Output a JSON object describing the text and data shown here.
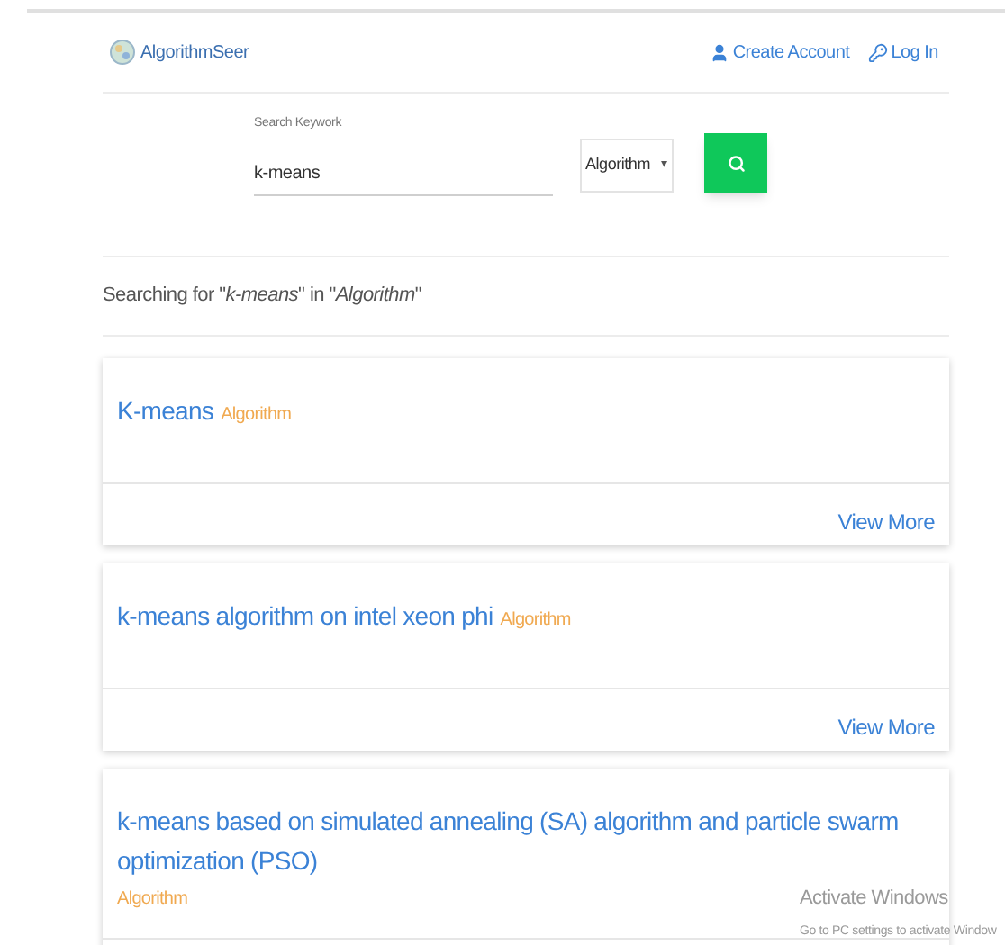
{
  "header": {
    "logo_text": "AlgorithmSeer",
    "links": [
      {
        "kind": "account",
        "label": "Create Account"
      },
      {
        "kind": "login",
        "label": "Log In"
      }
    ]
  },
  "search": {
    "label": "Search Keywork",
    "value": "k-means",
    "category": "Algorithm",
    "caret": "▾"
  },
  "summary": "Searching for \"*k-means*\" in \"*Algorithm*\"",
  "results": [
    {
      "title": "K-means",
      "tag": "Algorithm",
      "action": "View More"
    },
    {
      "title": "k-means algorithm on intel xeon phi",
      "tag": "Algorithm",
      "action": "View More"
    },
    {
      "title": "k-means based on simulated annealing (SA) algorithm and particle swarm optimization (PSO)",
      "tag": "Algorithm"
    }
  ],
  "os_notice": {
    "title": "Activate Windows",
    "text": "Go to PC settings to activate Window"
  }
}
